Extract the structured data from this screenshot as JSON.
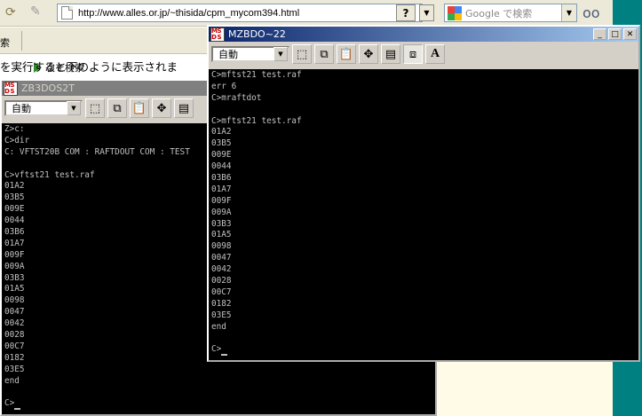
{
  "browser": {
    "url": "http://www.alles.or.jp/~thisida/cpm_mycom394.html",
    "search_placeholder": "Google で検索",
    "find_next_label": "次を検索",
    "page_text": "を実行すると下のように表示されま",
    "left_fragment": "索"
  },
  "back_window": {
    "title": "ZB3DOS2T",
    "mode": "自動",
    "lines": [
      "Z>c:",
      "C>dir",
      "C: VFTST20B COM : RAFTDOUT COM : TEST",
      "",
      "C>vftst21 test.raf",
      "01A2",
      "03B5",
      "009E",
      "0044",
      "03B6",
      "01A7",
      "009F",
      "009A",
      "03B3",
      "01A5",
      "0098",
      "0047",
      "0042",
      "0028",
      "00C7",
      "0182",
      "03E5",
      "end",
      "",
      "C>"
    ]
  },
  "front_window": {
    "title": "MZBDO~22",
    "mode": "自動",
    "lines": [
      "C>mftst21 test.raf",
      "err 6",
      "C>mraftdot",
      "",
      "C>mftst21 test.raf",
      "01A2",
      "03B5",
      "009E",
      "0044",
      "03B6",
      "01A7",
      "009F",
      "009A",
      "03B3",
      "01A5",
      "0098",
      "0047",
      "0042",
      "0028",
      "00C7",
      "0182",
      "03E5",
      "end",
      "",
      "C>"
    ]
  }
}
